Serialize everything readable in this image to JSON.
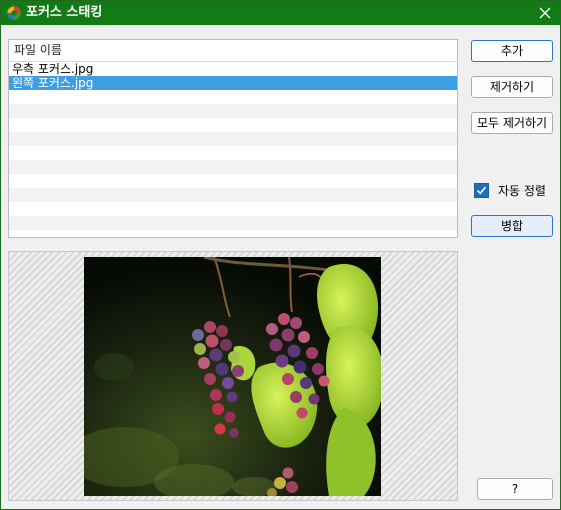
{
  "window": {
    "title": "포커스 스태킹",
    "accent_color": "#137b16"
  },
  "file_list": {
    "header": "파일 이름",
    "rows": [
      {
        "name": "우측 포커스.jpg",
        "selected": false
      },
      {
        "name": "왼쪽 포커스.jpg",
        "selected": true
      }
    ],
    "selection_color": "#3d9ee4"
  },
  "buttons": {
    "add": "추가",
    "remove": "제거하기",
    "remove_all": "모두 제거하기",
    "merge": "병합",
    "help": "?"
  },
  "options": {
    "auto_align_label": "자동 정렬",
    "auto_align_checked": true
  },
  "preview": {
    "image_subject": "grape-clusters-on-vine"
  },
  "icons": {
    "app": "app-logo-icon",
    "close": "close-icon",
    "check": "checkmark-icon"
  }
}
